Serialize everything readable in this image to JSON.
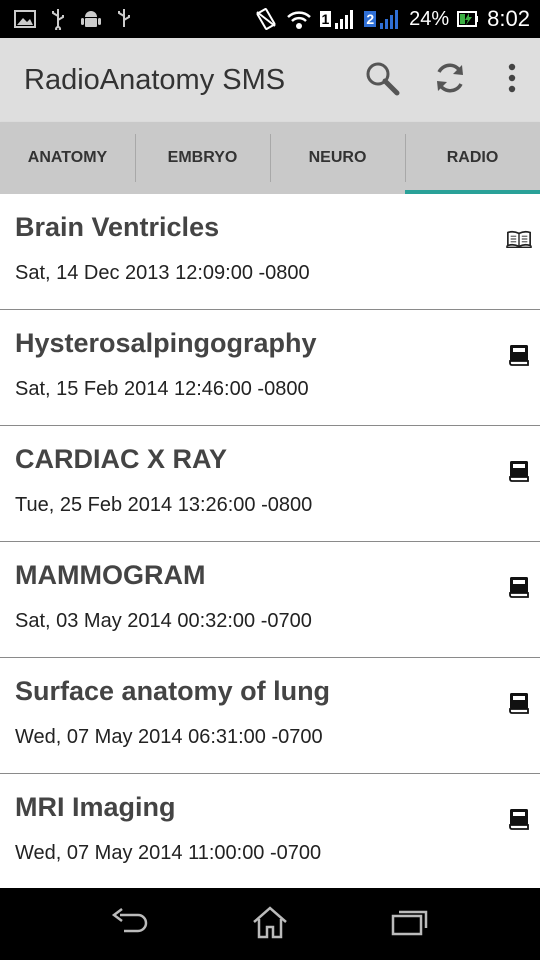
{
  "status_bar": {
    "sim1": "1",
    "sim2": "2",
    "battery": "24%",
    "time": "8:02"
  },
  "action_bar": {
    "title": "RadioAnatomy SMS",
    "icons": [
      "search-icon",
      "refresh-icon",
      "overflow-menu-icon"
    ]
  },
  "tabs": [
    {
      "label": "ANATOMY",
      "active": false
    },
    {
      "label": "EMBRYO",
      "active": false
    },
    {
      "label": "NEURO",
      "active": false
    },
    {
      "label": "RADIO",
      "active": true
    }
  ],
  "list": {
    "items": [
      {
        "title": "Brain Ventricles",
        "date": "Sat, 14 Dec 2013 12:09:00 -0800",
        "icon": "open-book-icon"
      },
      {
        "title": "Hysterosalpingography",
        "date": "Sat, 15 Feb 2014 12:46:00 -0800",
        "icon": "closed-book-icon"
      },
      {
        "title": "CARDIAC X RAY",
        "date": "Tue, 25 Feb 2014 13:26:00 -0800",
        "icon": "closed-book-icon"
      },
      {
        "title": "MAMMOGRAM",
        "date": "Sat, 03 May 2014 00:32:00 -0700",
        "icon": "closed-book-icon"
      },
      {
        "title": "Surface anatomy of lung",
        "date": "Wed, 07 May 2014 06:31:00 -0700",
        "icon": "closed-book-icon"
      },
      {
        "title": "MRI Imaging",
        "date": "Wed, 07 May 2014 11:00:00 -0700",
        "icon": "closed-book-icon"
      }
    ]
  },
  "colors": {
    "action_bar": "#dedede",
    "tab_bar": "#c9c9c9",
    "tab_indicator": "#2aa198",
    "status_bar": "#000000"
  }
}
